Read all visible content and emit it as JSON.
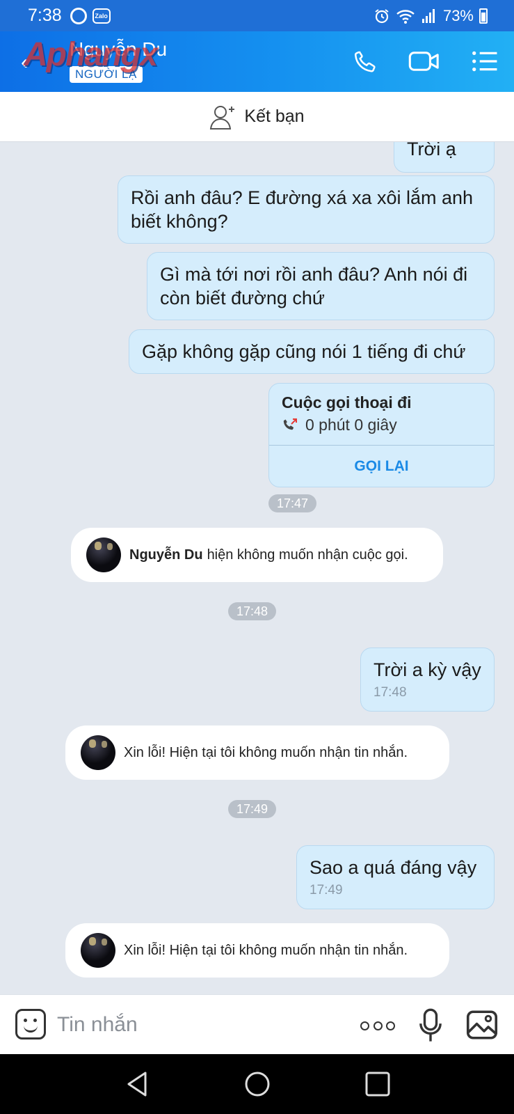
{
  "status_bar": {
    "time": "7:38",
    "zalo_badge": "Zalo",
    "battery": "73%"
  },
  "header": {
    "contact_name": "Nguyễn Du",
    "badge": "NGƯỜI LẠ",
    "watermark": "Aphangx"
  },
  "friend_bar": {
    "label": "Kết bạn"
  },
  "messages": {
    "partial_top": "Trời ạ",
    "m1": "Rồi anh đâu? E đường xá xa xôi lắm anh biết không?",
    "m2": "Gì mà tới nơi rồi anh đâu? Anh nói đi còn biết đường chứ",
    "m3": "Gặp không gặp cũng nói 1 tiếng đi chứ",
    "m4": "Trời a kỳ vậy",
    "m4_time": "17:48",
    "m5": "Sao a quá đáng vậy",
    "m5_time": "17:49"
  },
  "call_card": {
    "title": "Cuộc gọi thoại đi",
    "duration": "0 phút 0 giây",
    "call_back": "GỌI LẠI"
  },
  "time_pills": {
    "t1": "17:47",
    "t2": "17:48",
    "t3": "17:49"
  },
  "system": {
    "s1_name": "Nguyễn Du",
    "s1_text": "hiện không muốn nhận cuộc gọi.",
    "s2_text": "Xin lỗi! Hiện tại tôi không muốn nhận tin nhắn.",
    "s3_text": "Xin lỗi! Hiện tại tôi không muốn nhận tin nhắn."
  },
  "input_bar": {
    "placeholder": "Tin nhắn"
  },
  "colors": {
    "header_start": "#0d6fe6",
    "header_end": "#22b0f4",
    "bubble": "#d5edfc",
    "chat_bg": "#e3e8ef",
    "link": "#1a8ae6"
  }
}
